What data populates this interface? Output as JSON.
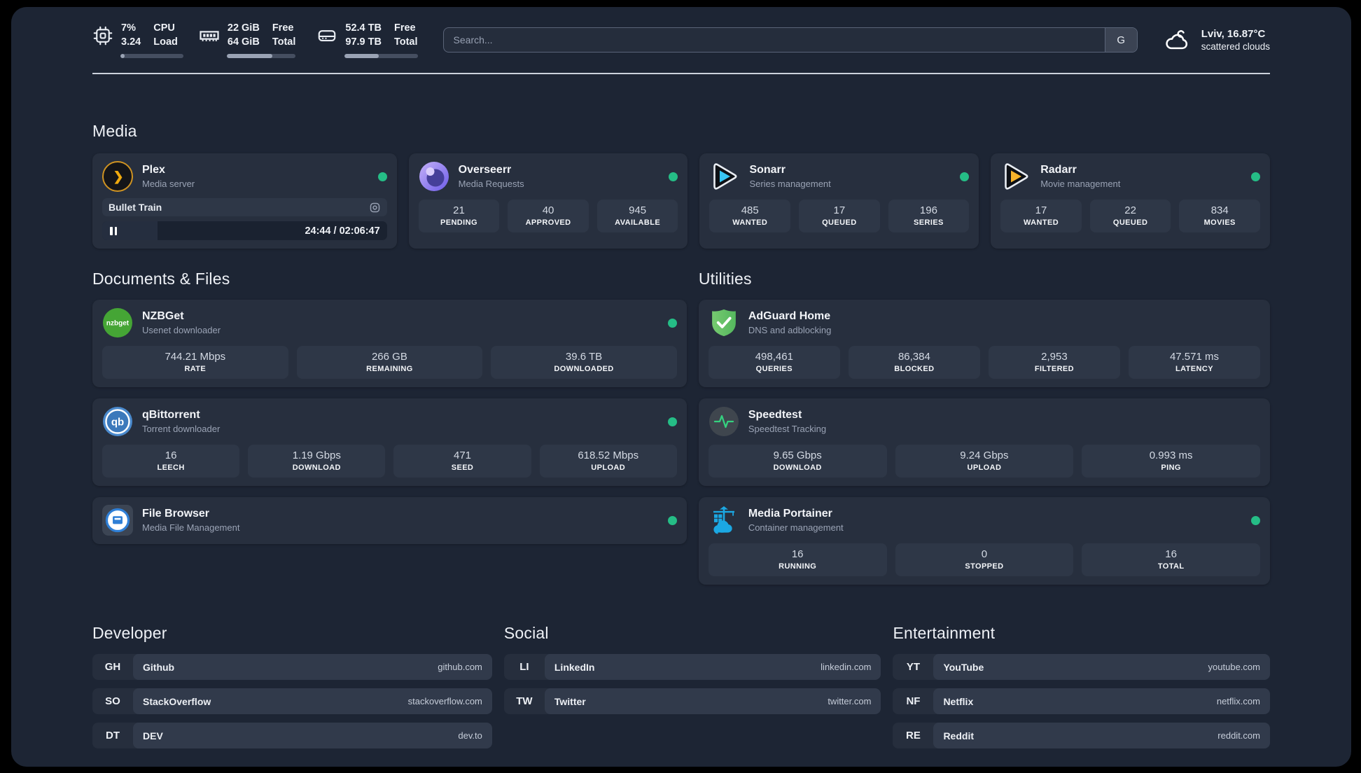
{
  "colors": {
    "accent_green": "#25bd86",
    "panel_bg": "#1d2534",
    "card_bg": "#272f3e",
    "portainer_blue": "#1ba8e3"
  },
  "header": {
    "system": {
      "cpu": {
        "value1": "7%",
        "value2": "3.24",
        "label1": "CPU",
        "label2": "Load",
        "progress": 7
      },
      "memory": {
        "value1": "22 GiB",
        "value2": "64 GiB",
        "label1": "Free",
        "label2": "Total",
        "progress": 66
      },
      "disk": {
        "value1": "52.4 TB",
        "value2": "97.9 TB",
        "label1": "Free",
        "label2": "Total",
        "progress": 47
      }
    },
    "search": {
      "placeholder": "Search...",
      "engine_label": "G"
    },
    "weather": {
      "location_temp": "Lviv, 16.87°C",
      "condition": "scattered clouds"
    }
  },
  "sections": {
    "media": {
      "title": "Media"
    },
    "documents": {
      "title": "Documents & Files"
    },
    "utilities": {
      "title": "Utilities"
    },
    "developer": {
      "title": "Developer"
    },
    "social": {
      "title": "Social"
    },
    "entertainment": {
      "title": "Entertainment"
    }
  },
  "apps": {
    "plex": {
      "name": "Plex",
      "subtitle": "Media server",
      "now_playing": {
        "title": "Bullet Train",
        "time": "24:44 / 02:06:47",
        "progress": 19.5
      }
    },
    "overseerr": {
      "name": "Overseerr",
      "subtitle": "Media Requests",
      "stats": [
        {
          "value": "21",
          "label": "PENDING"
        },
        {
          "value": "40",
          "label": "APPROVED"
        },
        {
          "value": "945",
          "label": "AVAILABLE"
        }
      ]
    },
    "sonarr": {
      "name": "Sonarr",
      "subtitle": "Series management",
      "stats": [
        {
          "value": "485",
          "label": "WANTED"
        },
        {
          "value": "17",
          "label": "QUEUED"
        },
        {
          "value": "196",
          "label": "SERIES"
        }
      ]
    },
    "radarr": {
      "name": "Radarr",
      "subtitle": "Movie management",
      "stats": [
        {
          "value": "17",
          "label": "WANTED"
        },
        {
          "value": "22",
          "label": "QUEUED"
        },
        {
          "value": "834",
          "label": "MOVIES"
        }
      ]
    },
    "nzbget": {
      "name": "NZBGet",
      "subtitle": "Usenet downloader",
      "logo_text": "nzbget",
      "stats": [
        {
          "value": "744.21 Mbps",
          "label": "RATE"
        },
        {
          "value": "266 GB",
          "label": "REMAINING"
        },
        {
          "value": "39.6 TB",
          "label": "DOWNLOADED"
        }
      ]
    },
    "qbittorrent": {
      "name": "qBittorrent",
      "subtitle": "Torrent downloader",
      "logo_text": "qb",
      "stats": [
        {
          "value": "16",
          "label": "LEECH"
        },
        {
          "value": "1.19 Gbps",
          "label": "DOWNLOAD"
        },
        {
          "value": "471",
          "label": "SEED"
        },
        {
          "value": "618.52 Mbps",
          "label": "UPLOAD"
        }
      ]
    },
    "filebrowser": {
      "name": "File Browser",
      "subtitle": "Media File Management"
    },
    "adguard": {
      "name": "AdGuard Home",
      "subtitle": "DNS and adblocking",
      "stats": [
        {
          "value": "498,461",
          "label": "QUERIES"
        },
        {
          "value": "86,384",
          "label": "BLOCKED"
        },
        {
          "value": "2,953",
          "label": "FILTERED"
        },
        {
          "value": "47.571 ms",
          "label": "LATENCY"
        }
      ]
    },
    "speedtest": {
      "name": "Speedtest",
      "subtitle": "Speedtest Tracking",
      "stats": [
        {
          "value": "9.65 Gbps",
          "label": "DOWNLOAD"
        },
        {
          "value": "9.24 Gbps",
          "label": "UPLOAD"
        },
        {
          "value": "0.993 ms",
          "label": "PING"
        }
      ]
    },
    "portainer": {
      "name": "Media Portainer",
      "subtitle": "Container management",
      "stats": [
        {
          "value": "16",
          "label": "RUNNING"
        },
        {
          "value": "0",
          "label": "STOPPED"
        },
        {
          "value": "16",
          "label": "TOTAL"
        }
      ]
    }
  },
  "bookmarks": {
    "developer": [
      {
        "abbr": "GH",
        "name": "Github",
        "url": "github.com"
      },
      {
        "abbr": "SO",
        "name": "StackOverflow",
        "url": "stackoverflow.com"
      },
      {
        "abbr": "DT",
        "name": "DEV",
        "url": "dev.to"
      }
    ],
    "social": [
      {
        "abbr": "LI",
        "name": "LinkedIn",
        "url": "linkedin.com"
      },
      {
        "abbr": "TW",
        "name": "Twitter",
        "url": "twitter.com"
      }
    ],
    "entertainment": [
      {
        "abbr": "YT",
        "name": "YouTube",
        "url": "youtube.com"
      },
      {
        "abbr": "NF",
        "name": "Netflix",
        "url": "netflix.com"
      },
      {
        "abbr": "RE",
        "name": "Reddit",
        "url": "reddit.com"
      }
    ]
  }
}
